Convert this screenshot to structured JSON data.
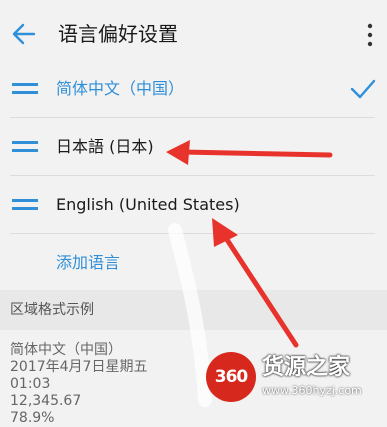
{
  "header": {
    "title": "语言偏好设置",
    "back_icon": "arrow-left-icon",
    "more_icon": "more-vertical-icon"
  },
  "languages": [
    {
      "label": "简体中文（中国）",
      "selected": true
    },
    {
      "label": "日本語 (日本)",
      "selected": false
    },
    {
      "label": "English (United States)",
      "selected": false
    }
  ],
  "add_language_label": "添加语言",
  "region_section": {
    "title": "区域格式示例",
    "examples": [
      "简体中文（中国）",
      "2017年4月7日星期五",
      "01:03",
      "12,345.67",
      "78.9%"
    ]
  },
  "watermark": {
    "logo_text": "360",
    "name": "货源之家",
    "url": "www.360hyzj.com"
  },
  "colors": {
    "accent": "#2f8fd9",
    "annotation_arrow": "#e8332c",
    "background": "#f2f2f2"
  }
}
